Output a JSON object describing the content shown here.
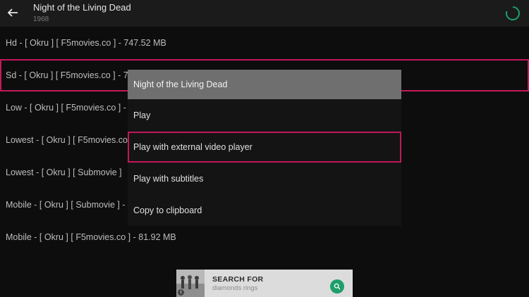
{
  "header": {
    "title": "Night of the Living Dead",
    "year": "1968",
    "back_icon": "arrow-left-icon",
    "loading_icon": "spinner-icon"
  },
  "sources": [
    {
      "label": "Hd  - [ Okru ]  [ F5movies.co ] - 747.52 MB"
    },
    {
      "label": "Sd  - [ Okru ]  [ F5movies.co ] - 7"
    },
    {
      "label": "Low  - [ Okru ]  [ F5movies.co ] -"
    },
    {
      "label": "Lowest  - [ Okru ]  [ F5movies.co"
    },
    {
      "label": "Lowest  - [ Okru ]  [ Submovie ]"
    },
    {
      "label": "Mobile  - [ Okru ]  [ Submovie ] -"
    },
    {
      "label": "Mobile  - [ Okru ]  [ F5movies.co ] - 81.92 MB"
    }
  ],
  "dialog": {
    "title": "Night of the Living Dead",
    "options": [
      {
        "label": "Play"
      },
      {
        "label": "Play with external video player"
      },
      {
        "label": "Play with subtitles"
      },
      {
        "label": "Copy to clipboard"
      }
    ]
  },
  "ad": {
    "headline": "SEARCH FOR",
    "subtext": "diamonds rings",
    "info_glyph": "i",
    "button_icon": "search-icon"
  },
  "colors": {
    "focus_border": "#c2185b",
    "ad_button": "#1e9e6a",
    "spinner": "#1e9e6a"
  }
}
